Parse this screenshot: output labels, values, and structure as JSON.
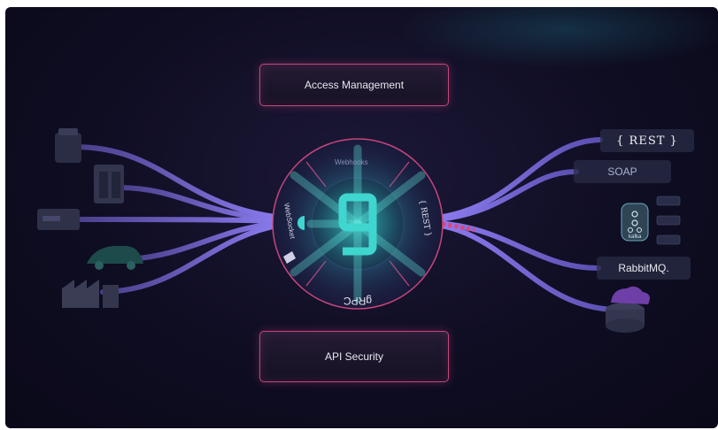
{
  "diagram": {
    "top_box": "Access Management",
    "bottom_box": "API Security",
    "center_logo": "g",
    "ring_segments": {
      "top": "Webhooks",
      "right": "{ REST }",
      "bottom": "gRPC",
      "left": "WebSocket"
    },
    "right_targets": {
      "rest": "{ REST }",
      "soap": "SOAP",
      "kafka": "kafka",
      "rabbitmq": "RabbitMQ."
    },
    "left_devices": [
      "device-icon",
      "server-rack-icon",
      "router-icon",
      "car-icon",
      "factory-icon"
    ],
    "right_extra_icons": [
      "kafka-icon",
      "cloud-database-icon"
    ],
    "colors": {
      "accent_teal": "#3fd6cf",
      "accent_pink": "#e0457c",
      "cable_purple": "#7b6ad8",
      "background": "#0f0d22"
    }
  }
}
